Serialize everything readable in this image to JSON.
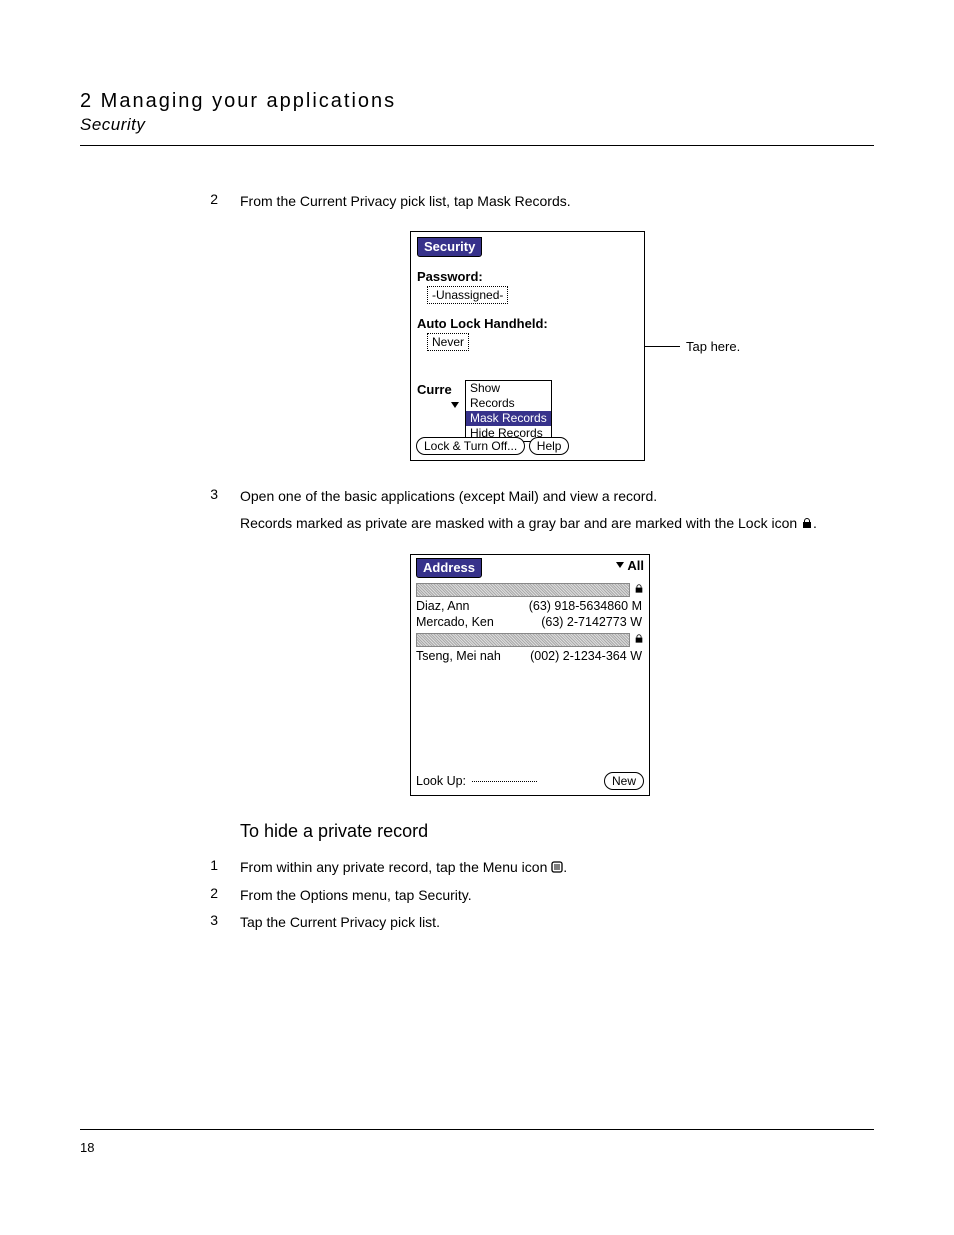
{
  "header": {
    "chapter": "2 Managing your applications",
    "section": "Security"
  },
  "steps_a": [
    {
      "num": "2",
      "text": "From the Current Privacy pick list, tap Mask Records."
    }
  ],
  "security_screen": {
    "title": "Security",
    "password_label": "Password:",
    "password_value": "-Unassigned-",
    "autolock_label": "Auto Lock Handheld:",
    "autolock_value": "Never",
    "curre_label": "Curre",
    "pick_options": {
      "show": "Show Records",
      "mask": "Mask Records",
      "hide": "Hide Records"
    },
    "lock_off": "Lock & Turn Off...",
    "help": "Help"
  },
  "callout_a": "Tap here.",
  "steps_b": {
    "num": "3",
    "line1": "Open one of the basic applications (except Mail) and view a record.",
    "line2a": "Records marked as private are masked with a gray bar and are marked with the Lock icon ",
    "line2b": "."
  },
  "address_screen": {
    "title": "Address",
    "all": "All",
    "rows": [
      {
        "name": "Diaz, Ann",
        "phone": "(63) 918-5634860",
        "suffix": "M"
      },
      {
        "name": "Mercado, Ken",
        "phone": "(63) 2-7142773",
        "suffix": "W"
      },
      {
        "name": "Tseng, Mei nah",
        "phone": "(002) 2-1234-364",
        "suffix": "W"
      }
    ],
    "lookup_label": "Look Up:",
    "new_btn": "New"
  },
  "subheading": "To hide a private record",
  "steps_c": [
    {
      "num": "1",
      "text": "From within any private record, tap the Menu icon ",
      "tail": "."
    },
    {
      "num": "2",
      "text": "From the Options menu, tap Security."
    },
    {
      "num": "3",
      "text": "Tap the Current Privacy pick list."
    }
  ],
  "page_number": "18"
}
